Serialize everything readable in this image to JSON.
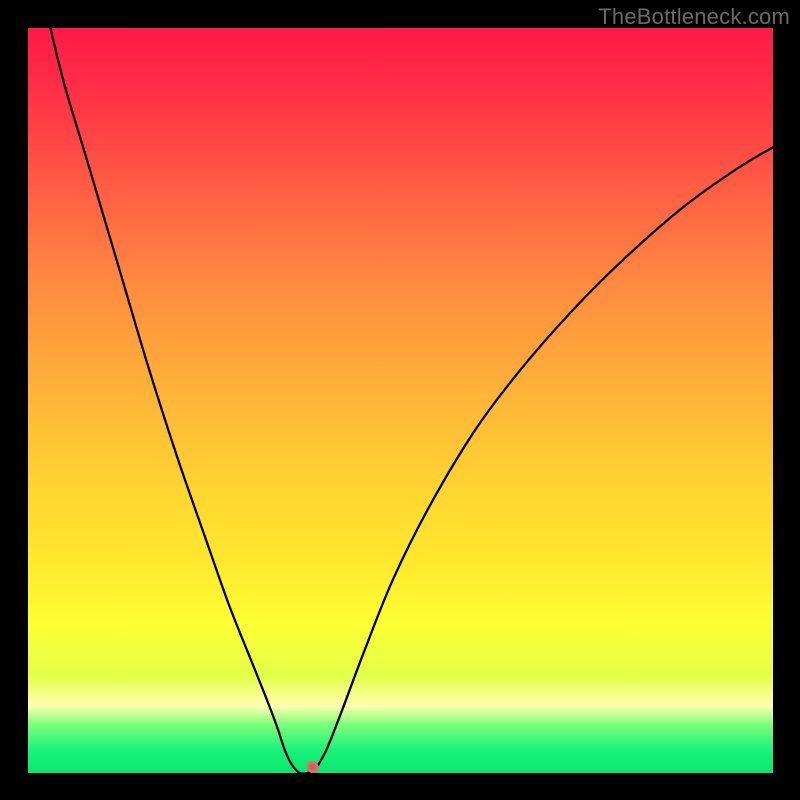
{
  "watermark": "TheBottleneck.com",
  "chart_data": {
    "type": "line",
    "title": "",
    "xlabel": "",
    "ylabel": "",
    "xlim": [
      0,
      100
    ],
    "ylim": [
      0,
      100
    ],
    "grid": false,
    "background_gradient": {
      "stops": [
        {
          "offset": 0.0,
          "color": "#ff1a48"
        },
        {
          "offset": 0.07,
          "color": "#ff2b47"
        },
        {
          "offset": 0.15,
          "color": "#ff4646"
        },
        {
          "offset": 0.25,
          "color": "#ff6a43"
        },
        {
          "offset": 0.35,
          "color": "#ff8c40"
        },
        {
          "offset": 0.5,
          "color": "#ffb638"
        },
        {
          "offset": 0.62,
          "color": "#ffd531"
        },
        {
          "offset": 0.72,
          "color": "#ffe92e"
        },
        {
          "offset": 0.8,
          "color": "#fcff33"
        },
        {
          "offset": 0.87,
          "color": "#e4ff48"
        },
        {
          "offset": 0.91,
          "color": "#ffffb0"
        },
        {
          "offset": 0.935,
          "color": "#7cff7a"
        },
        {
          "offset": 0.97,
          "color": "#18f27a"
        },
        {
          "offset": 1.0,
          "color": "#0de56f"
        }
      ]
    },
    "series": [
      {
        "name": "bottleneck-curve",
        "color": "#000000",
        "width": 2.3,
        "points": [
          {
            "x": 3.0,
            "y": 100.0
          },
          {
            "x": 5.0,
            "y": 92.0
          },
          {
            "x": 8.0,
            "y": 82.0
          },
          {
            "x": 12.0,
            "y": 68.5
          },
          {
            "x": 16.0,
            "y": 55.0
          },
          {
            "x": 20.0,
            "y": 42.5
          },
          {
            "x": 24.0,
            "y": 31.0
          },
          {
            "x": 27.0,
            "y": 22.5
          },
          {
            "x": 30.0,
            "y": 15.0
          },
          {
            "x": 32.0,
            "y": 10.0
          },
          {
            "x": 33.5,
            "y": 6.0
          },
          {
            "x": 34.5,
            "y": 3.0
          },
          {
            "x": 35.5,
            "y": 1.0
          },
          {
            "x": 36.5,
            "y": 0.0
          },
          {
            "x": 37.5,
            "y": 0.0
          },
          {
            "x": 38.5,
            "y": 0.5
          },
          {
            "x": 40.0,
            "y": 3.0
          },
          {
            "x": 42.0,
            "y": 8.0
          },
          {
            "x": 45.0,
            "y": 16.0
          },
          {
            "x": 49.0,
            "y": 26.0
          },
          {
            "x": 54.0,
            "y": 36.0
          },
          {
            "x": 60.0,
            "y": 46.0
          },
          {
            "x": 66.0,
            "y": 54.0
          },
          {
            "x": 73.0,
            "y": 62.0
          },
          {
            "x": 80.0,
            "y": 69.0
          },
          {
            "x": 88.0,
            "y": 76.0
          },
          {
            "x": 95.0,
            "y": 81.0
          },
          {
            "x": 100.0,
            "y": 84.0
          }
        ]
      }
    ],
    "marker": {
      "x": 38.2,
      "y": 0.8,
      "color": "#e46b6c",
      "radius_px": 6
    }
  }
}
